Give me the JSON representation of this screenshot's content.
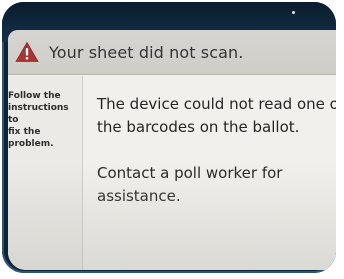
{
  "header": {
    "icon": "warning-icon",
    "icon_color": "#a93431",
    "title": "Your sheet did not scan."
  },
  "sidebar": {
    "instructions": "Follow the\ninstructions to\nfix the\nproblem."
  },
  "message": {
    "line1a": "The device could not read one of",
    "line1b": "the barcodes on the ballot.",
    "line2a": "Contact a poll worker for",
    "line2b": "assistance."
  }
}
